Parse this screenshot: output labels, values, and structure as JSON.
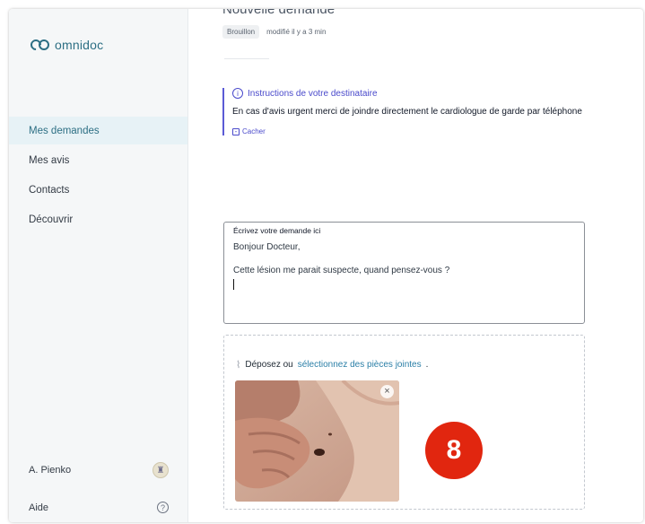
{
  "app": {
    "name": "omnidoc"
  },
  "sidebar": {
    "items": [
      {
        "label": "Mes demandes",
        "active": true
      },
      {
        "label": "Mes avis",
        "active": false
      },
      {
        "label": "Contacts",
        "active": false
      },
      {
        "label": "Découvrir",
        "active": false
      }
    ],
    "user": {
      "name": "A. Pienko"
    },
    "help": {
      "label": "Aide",
      "icon": "help-circle-icon"
    }
  },
  "request": {
    "title": "Nouvelle demande",
    "status": "Brouillon",
    "modified": "modifié il y a 3 min"
  },
  "instructions": {
    "title": "Instructions de votre destinataire",
    "body": "En cas d'avis urgent merci de joindre directement le cardiologue de garde par téléphone",
    "hide_label": "Cacher"
  },
  "editor": {
    "label": "Écrivez votre demande ici",
    "lines": [
      "Bonjour Docteur,",
      "Cette lésion me parait suspecte, quand pensez-vous ?"
    ]
  },
  "attachments": {
    "drop_prefix": "Déposez ou",
    "drop_link": "sélectionnez des pièces jointes",
    "drop_suffix": "."
  },
  "step_badge": "8",
  "colors": {
    "accent": "#2d6f84",
    "link": "#4a4acb",
    "badge": "#e1260f"
  }
}
